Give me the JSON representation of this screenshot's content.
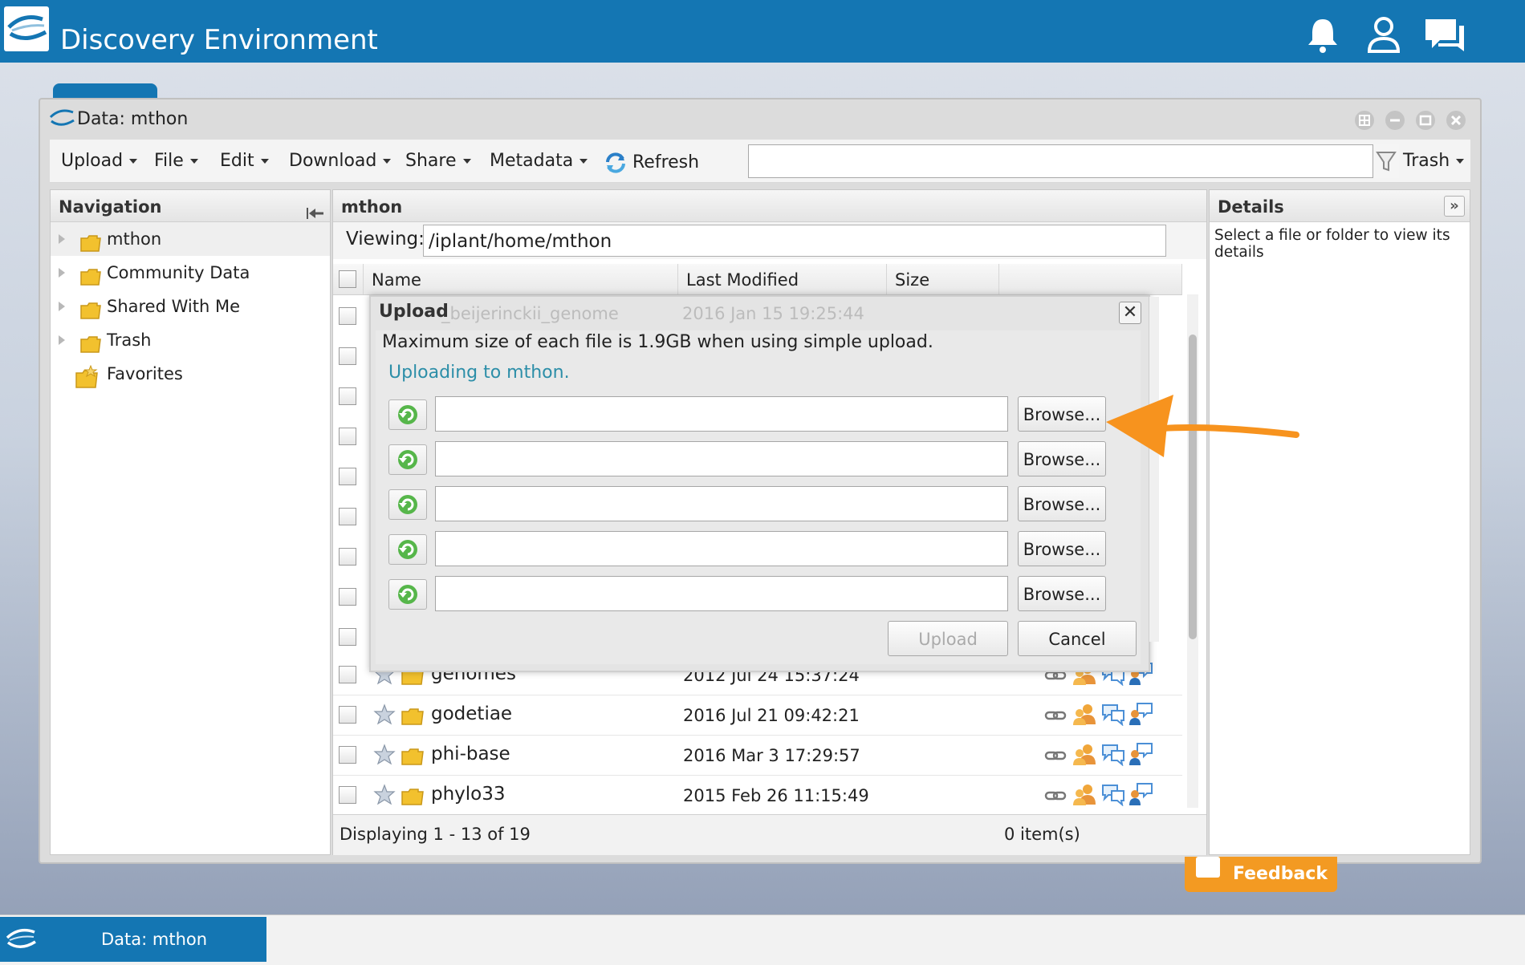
{
  "app": {
    "title": "Discovery Environment",
    "header_icons": [
      "bell-icon",
      "user-icon",
      "chat-icon"
    ]
  },
  "window": {
    "title": "Data: mthon",
    "controls": [
      "layout-icon",
      "minimize-icon",
      "maximize-icon",
      "close-icon"
    ]
  },
  "toolbar": {
    "upload": "Upload",
    "file": "File",
    "edit": "Edit",
    "download": "Download",
    "share": "Share",
    "metadata": "Metadata",
    "refresh": "Refresh",
    "search_value": "",
    "trash": "Trash"
  },
  "navigation": {
    "heading": "Navigation",
    "items": [
      {
        "label": "mthon",
        "selected": true
      },
      {
        "label": "Community Data"
      },
      {
        "label": "Shared With Me"
      },
      {
        "label": "Trash"
      },
      {
        "label": "Favorites"
      }
    ]
  },
  "center": {
    "heading": "mthon",
    "viewing_label": "Viewing:",
    "path": "/iplant/home/mthon",
    "columns": {
      "name": "Name",
      "last_modified": "Last Modified",
      "size": "Size"
    },
    "rows": [
      {
        "name": "genomes",
        "modified": "2012 Jul 24 15:37:24"
      },
      {
        "name": "godetiae",
        "modified": "2016 Jul 21 09:42:21"
      },
      {
        "name": "phi-base",
        "modified": "2016 Mar 3 17:29:57"
      },
      {
        "name": "phylo33",
        "modified": "2015 Feb 26 11:15:49"
      }
    ],
    "footer_range": "Displaying 1 - 13 of 19",
    "footer_selected": "0 item(s)"
  },
  "details": {
    "heading": "Details",
    "hint": "Select a file or folder to view its details"
  },
  "upload_dialog": {
    "title": "Upload",
    "behind_row_name": "_beijerinckii_genome",
    "behind_row_date": "2016 Jan 15 19:25:44",
    "info": "Maximum size of each file is 1.9GB when using simple upload.",
    "status": "Uploading to mthon.",
    "browse_label": "Browse...",
    "upload_label": "Upload",
    "cancel_label": "Cancel",
    "file_slots": 5
  },
  "feedback": {
    "label": "Feedback"
  },
  "taskbar": {
    "label": "Data: mthon"
  },
  "colors": {
    "brand": "#1476b3",
    "accent": "#f7931e",
    "status": "#2c8ea8"
  }
}
